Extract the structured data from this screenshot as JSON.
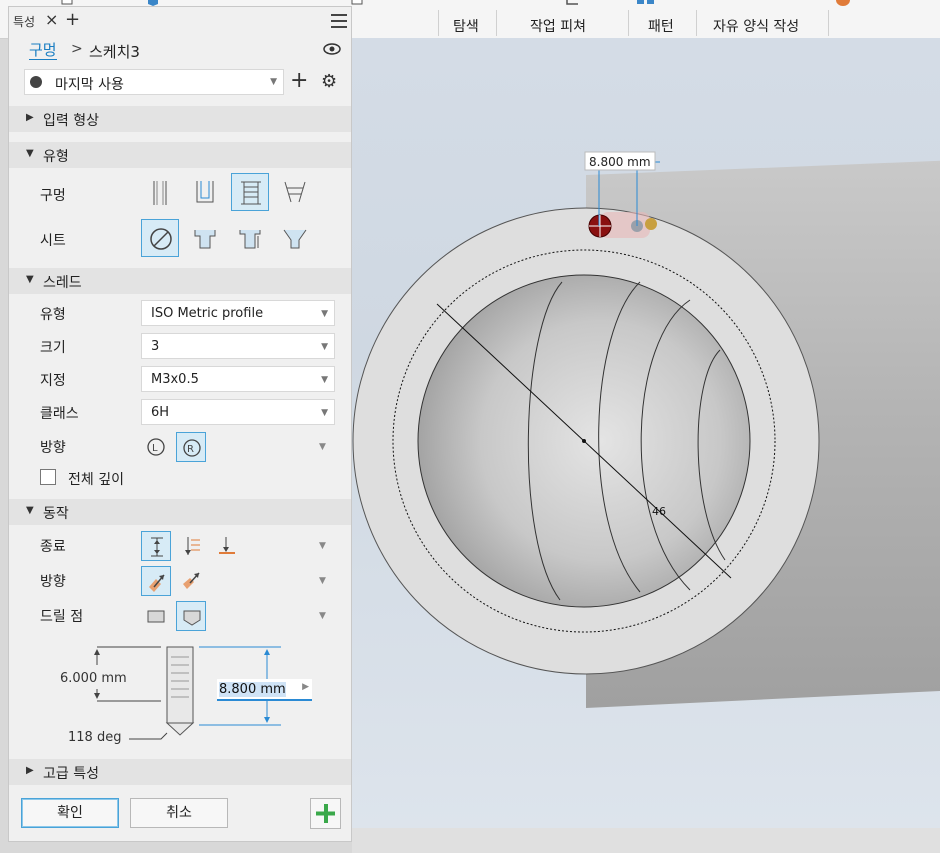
{
  "ribbon": {
    "labels": [
      "탐색",
      "작업 피쳐",
      "패턴",
      "자유 양식 작성"
    ]
  },
  "panel": {
    "tab_label": "특성",
    "breadcrumb": {
      "feature": "구멍",
      "sketch": "스케치3"
    },
    "preset": "마지막 사용",
    "sections": {
      "input_geometry": "입력 형상",
      "type": "유형",
      "thread": "스레드",
      "behavior": "동작",
      "advanced": "고급 특성"
    },
    "type_rows": {
      "hole": "구멍",
      "seat": "시트"
    },
    "thread_rows": {
      "type_label": "유형",
      "type_value": "ISO Metric profile",
      "size_label": "크기",
      "size_value": "3",
      "designation_label": "지정",
      "designation_value": "M3x0.5",
      "class_label": "클래스",
      "class_value": "6H",
      "direction_label": "방향",
      "full_depth_label": "전체 깊이"
    },
    "behavior_rows": {
      "termination": "종료",
      "direction": "방향",
      "drill_point": "드릴 점"
    },
    "diagram": {
      "thread_depth": "6.000 mm",
      "hole_depth": "8.800 mm",
      "drill_angle": "118 deg"
    },
    "buttons": {
      "ok": "확인",
      "cancel": "취소"
    }
  },
  "viewport": {
    "dimension_label": "8.800 mm",
    "diameter_label": "46"
  }
}
